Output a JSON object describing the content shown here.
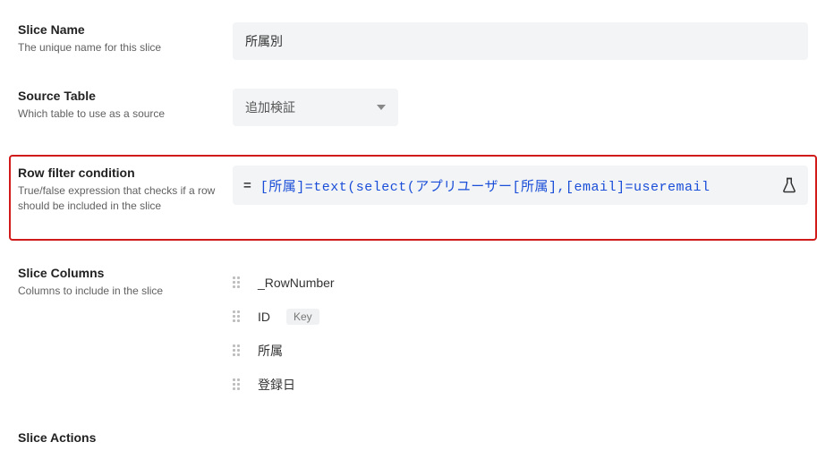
{
  "sliceName": {
    "title": "Slice Name",
    "desc": "The unique name for this slice",
    "value": "所属別"
  },
  "sourceTable": {
    "title": "Source Table",
    "desc": "Which table to use as a source",
    "value": "追加検証"
  },
  "rowFilter": {
    "title": "Row filter condition",
    "desc": "True/false expression that checks if a row should be included in the slice",
    "formula": "[所属]=text(select(アプリユーザー[所属],[email]=useremail"
  },
  "sliceColumns": {
    "title": "Slice Columns",
    "desc": "Columns to include in the slice",
    "items": [
      {
        "name": "_RowNumber",
        "key": false
      },
      {
        "name": "ID",
        "key": true
      },
      {
        "name": "所属",
        "key": false
      },
      {
        "name": "登録日",
        "key": false
      }
    ],
    "keyLabel": "Key"
  },
  "sliceActions": {
    "title": "Slice Actions"
  }
}
